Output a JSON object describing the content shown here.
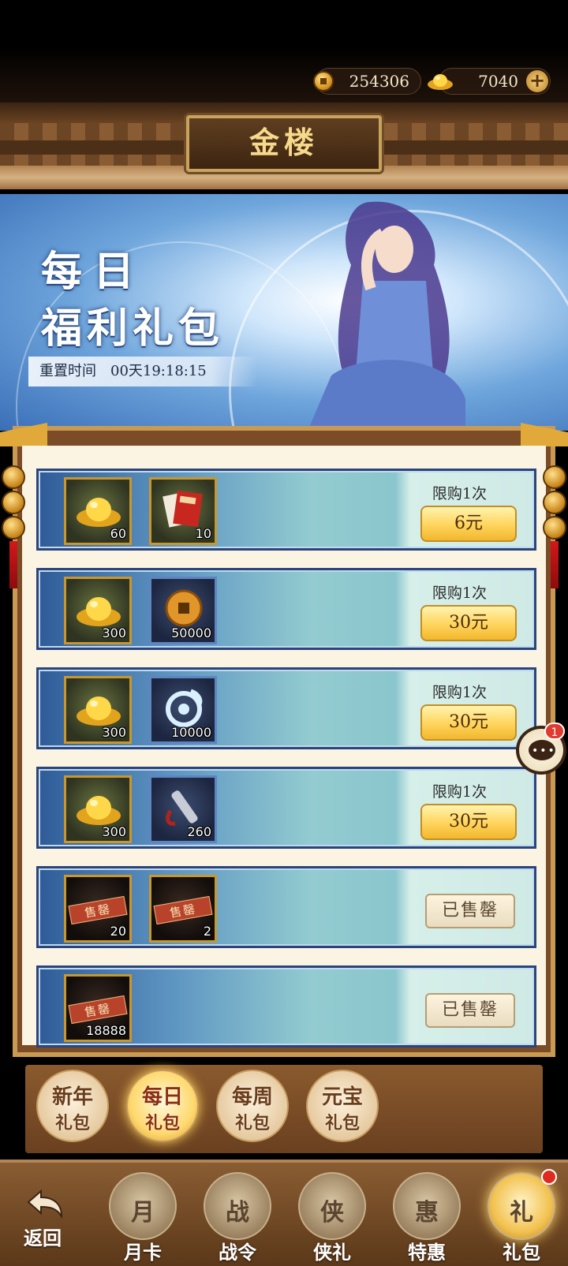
{
  "currency": {
    "coins": "254306",
    "gold_ingots": "7040",
    "add_label": "+"
  },
  "header": {
    "title": "金楼"
  },
  "banner": {
    "title_line1": "每日",
    "title_line2": "福利礼包",
    "reset_label": "重置时间",
    "reset_time": "00天19:18:15"
  },
  "packs": [
    {
      "items": [
        {
          "icon": "gold-ingot",
          "qty": "60"
        },
        {
          "icon": "red-envelope-letters",
          "qty": "10"
        }
      ],
      "limit": "限购1次",
      "price": "6元",
      "sold_out": false
    },
    {
      "items": [
        {
          "icon": "gold-ingot",
          "qty": "300"
        },
        {
          "icon": "copper-coin",
          "qty": "50000"
        }
      ],
      "limit": "限购1次",
      "price": "30元",
      "sold_out": false
    },
    {
      "items": [
        {
          "icon": "gold-ingot",
          "qty": "300"
        },
        {
          "icon": "spirit-swirl",
          "qty": "10000"
        }
      ],
      "limit": "限购1次",
      "price": "30元",
      "sold_out": false
    },
    {
      "items": [
        {
          "icon": "gold-ingot",
          "qty": "300"
        },
        {
          "icon": "scroll",
          "qty": "260"
        }
      ],
      "limit": "限购1次",
      "price": "30元",
      "sold_out": false
    },
    {
      "items": [
        {
          "icon": "sold-out-item",
          "qty": "20",
          "tag": "售罄"
        },
        {
          "icon": "sold-out-item",
          "qty": "2",
          "tag": "售罄"
        }
      ],
      "status": "已售罄",
      "sold_out": true
    },
    {
      "items": [
        {
          "icon": "sold-out-item",
          "qty": "18888",
          "tag": "售罄"
        }
      ],
      "status": "已售罄",
      "sold_out": true
    }
  ],
  "chat": {
    "badge": "1",
    "dots": "•••"
  },
  "gift_tabs": [
    {
      "line1": "新年",
      "line2": "礼包",
      "active": false
    },
    {
      "line1": "每日",
      "line2": "礼包",
      "active": true
    },
    {
      "line1": "每周",
      "line2": "礼包",
      "active": false
    },
    {
      "line1": "元宝",
      "line2": "礼包",
      "active": false
    }
  ],
  "bottom_nav": {
    "back": "返回",
    "items": [
      {
        "label": "月卡",
        "glyph": "月",
        "active": false
      },
      {
        "label": "战令",
        "glyph": "战",
        "active": false
      },
      {
        "label": "侠礼",
        "glyph": "侠",
        "active": false
      },
      {
        "label": "特惠",
        "glyph": "惠",
        "active": false
      },
      {
        "label": "礼包",
        "glyph": "礼",
        "active": true,
        "badge": true
      }
    ]
  },
  "colors": {
    "accent_gold": "#ffd45c",
    "frame_brown": "#7b4c25",
    "row_blue": "#2f5c98",
    "badge_red": "#e23a2c"
  }
}
